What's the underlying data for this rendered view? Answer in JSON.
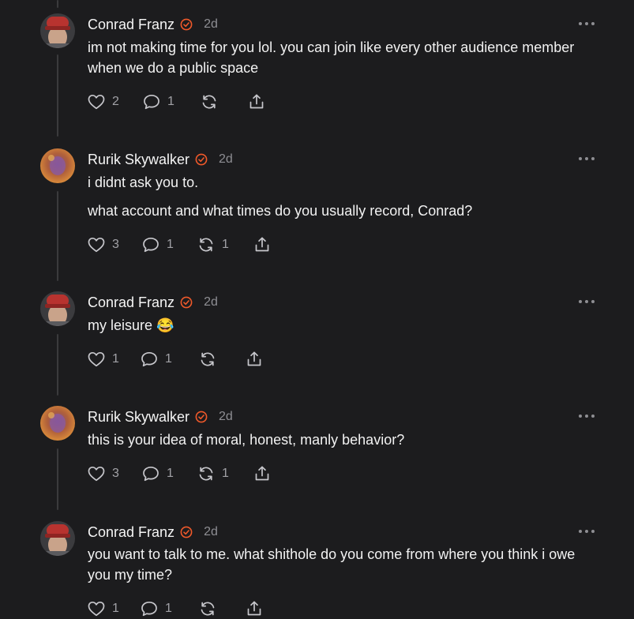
{
  "posts": [
    {
      "author": "Conrad Franz",
      "time": "2d",
      "avatar": "conrad",
      "paragraphs": [
        "im not making time for you lol. you can join like every other audience member when we do a public space"
      ],
      "likes": "2",
      "replies": "1",
      "reposts": ""
    },
    {
      "author": "Rurik Skywalker",
      "time": "2d",
      "avatar": "rurik",
      "paragraphs": [
        "i didnt ask you to.",
        "what account and what times do you usually record, Conrad?"
      ],
      "likes": "3",
      "replies": "1",
      "reposts": "1"
    },
    {
      "author": "Conrad Franz",
      "time": "2d",
      "avatar": "conrad",
      "paragraphs": [
        "my leisure 😂"
      ],
      "likes": "1",
      "replies": "1",
      "reposts": ""
    },
    {
      "author": "Rurik Skywalker",
      "time": "2d",
      "avatar": "rurik",
      "paragraphs": [
        "this is your idea of moral, honest, manly behavior?"
      ],
      "likes": "3",
      "replies": "1",
      "reposts": "1"
    },
    {
      "author": "Conrad Franz",
      "time": "2d",
      "avatar": "conrad",
      "paragraphs": [
        "you want to talk to me. what shithole do you come from where you think i owe you my time?"
      ],
      "likes": "1",
      "replies": "1",
      "reposts": ""
    }
  ],
  "colors": {
    "background": "#1c1c1e",
    "verified": "#f0592a",
    "muted": "#8e8e93",
    "thread_line": "#3a3a3c"
  },
  "icons": {
    "verified": "verified-badge-icon",
    "like": "heart-icon",
    "reply": "comment-icon",
    "repost": "repost-icon",
    "share": "share-icon",
    "more": "more-dots-icon"
  }
}
